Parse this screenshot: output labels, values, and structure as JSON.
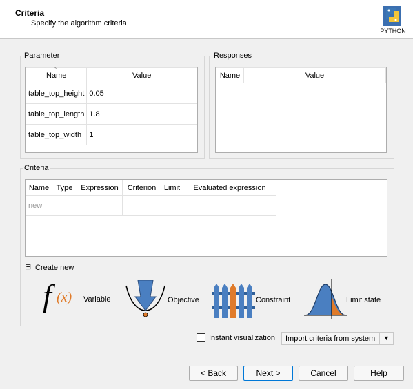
{
  "header": {
    "title": "Criteria",
    "subtitle": "Specify the algorithm criteria",
    "logo_label": "PYTHON"
  },
  "parameter": {
    "label": "Parameter",
    "columns": [
      "Name",
      "Value"
    ],
    "rows": [
      {
        "name": "table_top_height",
        "value": "0.05"
      },
      {
        "name": "table_top_length",
        "value": "1.8"
      },
      {
        "name": "table_top_width",
        "value": "1"
      }
    ]
  },
  "responses": {
    "label": "Responses",
    "columns": [
      "Name",
      "Value"
    ]
  },
  "criteria": {
    "label": "Criteria",
    "columns": [
      "Name",
      "Type",
      "Expression",
      "Criterion",
      "Limit",
      "Evaluated expression"
    ],
    "new_row": "new",
    "create_new_label": "Create new",
    "toggle": "⊟",
    "types": [
      {
        "label": "Variable",
        "icon": "function-icon"
      },
      {
        "label": "Objective",
        "icon": "objective-icon"
      },
      {
        "label": "Constraint",
        "icon": "constraint-icon"
      },
      {
        "label": "Limit state",
        "icon": "limit-state-icon"
      }
    ]
  },
  "options": {
    "instant_visualization": "Instant visualization",
    "instant_checked": false,
    "import_label": "Import criteria from system"
  },
  "buttons": {
    "back": "< Back",
    "next": "Next >",
    "cancel": "Cancel",
    "help": "Help"
  },
  "colors": {
    "accent": "#0078d7",
    "blue_fill": "#4a7fc1",
    "orange": "#e07b2a"
  }
}
